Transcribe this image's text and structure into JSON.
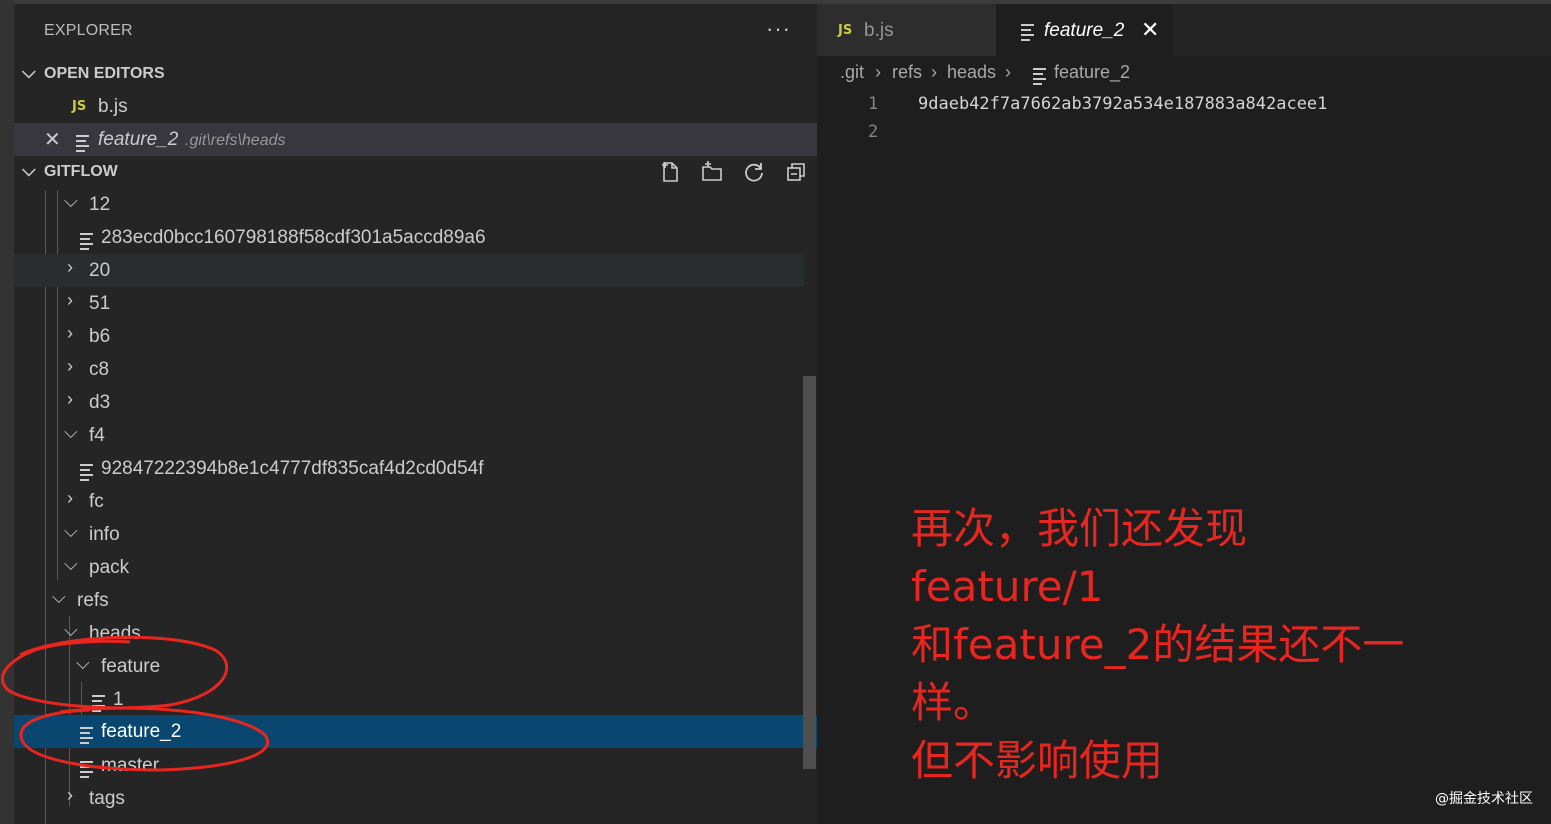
{
  "explorer": {
    "title": "EXPLORER",
    "more_icon": "more-actions-icon",
    "open_editors": {
      "header": "OPEN EDITORS",
      "items": [
        {
          "icon": "js-file-icon",
          "badge": "JS",
          "name": "b.js",
          "path": ""
        },
        {
          "icon": "text-file-icon",
          "name": "feature_2",
          "path": ".git\\refs\\heads",
          "close_icon": "close-icon"
        }
      ]
    },
    "gitflow": {
      "header": "GITFLOW",
      "toolbar": [
        "new-file-icon",
        "new-folder-icon",
        "refresh-icon",
        "collapse-all-icon"
      ],
      "rows": [
        {
          "label": "12",
          "type": "folder-open"
        },
        {
          "label": "283ecd0bcc160798188f58cdf301a5accd89a6",
          "type": "file"
        },
        {
          "label": "20",
          "type": "folder-closed"
        },
        {
          "label": "51",
          "type": "folder-closed"
        },
        {
          "label": "b6",
          "type": "folder-closed"
        },
        {
          "label": "c8",
          "type": "folder-closed"
        },
        {
          "label": "d3",
          "type": "folder-closed"
        },
        {
          "label": "f4",
          "type": "folder-open"
        },
        {
          "label": "92847222394b8e1c4777df835caf4d2cd0d54f",
          "type": "file"
        },
        {
          "label": "fc",
          "type": "folder-closed"
        },
        {
          "label": "info",
          "type": "folder-open"
        },
        {
          "label": "pack",
          "type": "folder-open"
        },
        {
          "label": "refs",
          "type": "folder-open"
        },
        {
          "label": "heads",
          "type": "folder-open"
        },
        {
          "label": "feature",
          "type": "folder-open"
        },
        {
          "label": "1",
          "type": "file"
        },
        {
          "label": "feature_2",
          "type": "file"
        },
        {
          "label": "master",
          "type": "file"
        },
        {
          "label": "tags",
          "type": "folder-closed"
        }
      ]
    }
  },
  "editor": {
    "tabs": [
      {
        "badge": "JS",
        "label": "b.js",
        "active": false
      },
      {
        "label": "feature_2",
        "active": true,
        "close_icon": "close-icon"
      }
    ],
    "breadcrumb": [
      ".git",
      "refs",
      "heads",
      "feature_2"
    ],
    "lines": [
      {
        "number": "1",
        "text": "9daeb42f7a7662ab3792a534e187883a842acee1"
      },
      {
        "number": "2",
        "text": ""
      }
    ]
  },
  "annotation": {
    "color": "#e8261f",
    "lines": [
      "再次，我们还发现",
      "feature/1",
      "和feature_2的结果还不一",
      "样。",
      "但不影响使用"
    ]
  },
  "watermark": "@掘金技术社区",
  "colors": {
    "selection": "#094771",
    "sidebar_bg": "#252526",
    "editor_bg": "#1e1e1e",
    "js_badge": "#cbcb41"
  }
}
